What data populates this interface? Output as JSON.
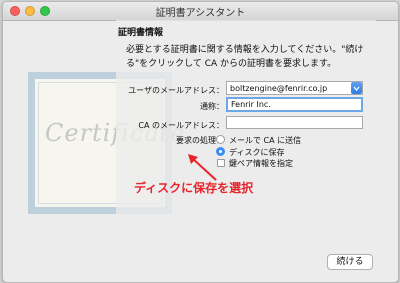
{
  "window": {
    "title": "証明書アシスタント"
  },
  "certificate_watermark": "Certificate",
  "section": {
    "title": "証明書情報",
    "description": "必要とする証明書に関する情報を入力してください。\"続ける\"をクリックして CA からの証明書を要求します。"
  },
  "form": {
    "user_email_label": "ユーザのメールアドレス：",
    "user_email_value": "boltzengine@fenrir.co.jp",
    "common_name_label": "通称：",
    "common_name_value": "Fenrir Inc.",
    "ca_email_label": "CA のメールアドレス：",
    "ca_email_value": "",
    "request_label": "要求の処理：",
    "options": [
      {
        "label": "メールで CA に送信",
        "selected": false
      },
      {
        "label": "ディスクに保存",
        "selected": true
      }
    ],
    "keypair_label": "鍵ペア情報を指定",
    "keypair_checked": false
  },
  "annotation": {
    "text": "ディスクに保存を選択",
    "color": "#e8242b"
  },
  "footer": {
    "continue_label": "続ける"
  },
  "colors": {
    "accent": "#3b8ef0",
    "focus_ring": "#6ea7e8"
  }
}
